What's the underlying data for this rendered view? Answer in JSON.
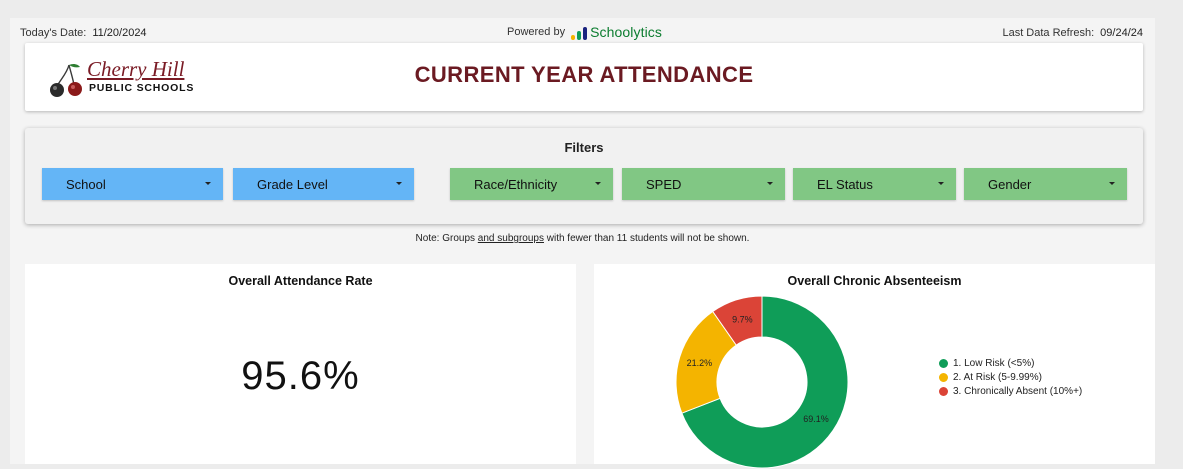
{
  "topbar": {
    "date_label": "Today's Date:",
    "date_value": "11/20/2024",
    "powered_label": "Powered by",
    "brand_name": "Schoolytics",
    "refresh_label": "Last Data Refresh:",
    "refresh_value": "09/24/24"
  },
  "header": {
    "logo_script": "Cherry Hill",
    "logo_sub": "PUBLIC SCHOOLS",
    "title": "CURRENT YEAR ATTENDANCE"
  },
  "filters": {
    "title": "Filters",
    "items": [
      {
        "label": "School",
        "color": "#64b5f6"
      },
      {
        "label": "Grade Level",
        "color": "#64b5f6"
      },
      {
        "label": "Race/Ethnicity",
        "color": "#81c784"
      },
      {
        "label": "SPED",
        "color": "#81c784"
      },
      {
        "label": "EL Status",
        "color": "#81c784"
      },
      {
        "label": "Gender",
        "color": "#81c784"
      }
    ]
  },
  "note": {
    "before": "Note: Groups ",
    "underlined": "and subgroups",
    "after": " with fewer than 11 students will not be shown."
  },
  "attendance": {
    "title": "Overall Attendance Rate",
    "value": "95.6%"
  },
  "absenteeism": {
    "title": "Overall Chronic Absenteeism"
  },
  "chart_data": {
    "type": "pie",
    "title": "Overall Chronic Absenteeism",
    "donut": true,
    "legend_position": "right",
    "slices": [
      {
        "label": "1. Low Risk (<5%)",
        "value": 69.1,
        "display": "69.1%",
        "color": "#0f9d58"
      },
      {
        "label": "2. At Risk (5-9.99%)",
        "value": 21.2,
        "display": "21.2%",
        "color": "#f4b400"
      },
      {
        "label": "3. Chronically Absent (10%+)",
        "value": 9.7,
        "display": "9.7%",
        "color": "#db4437"
      }
    ]
  },
  "colors": {
    "title": "#6b1a22",
    "brand_green": "#0b7c2f"
  }
}
